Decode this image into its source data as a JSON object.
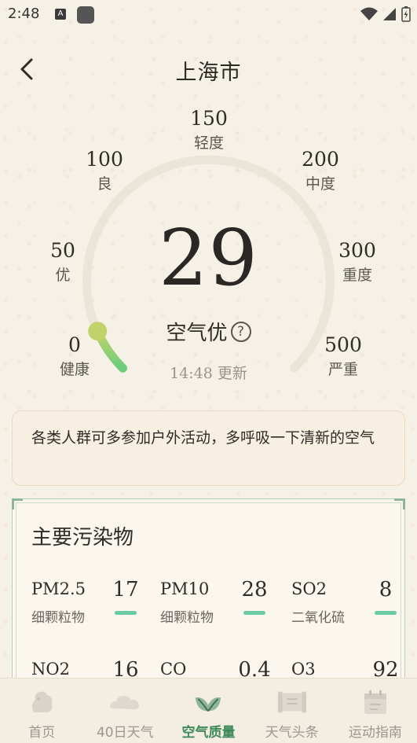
{
  "status_bar": {
    "time": "2:48",
    "notification_letter": "A"
  },
  "header": {
    "title": "上海市"
  },
  "gauge": {
    "scale": [
      {
        "value": "0",
        "label": "健康"
      },
      {
        "value": "50",
        "label": "优"
      },
      {
        "value": "100",
        "label": "良"
      },
      {
        "value": "150",
        "label": "轻度"
      },
      {
        "value": "200",
        "label": "中度"
      },
      {
        "value": "300",
        "label": "重度"
      },
      {
        "value": "500",
        "label": "严重"
      }
    ],
    "aqi": "29",
    "aqi_numeric": 29,
    "level_text": "空气优",
    "help_symbol": "?",
    "update_text": "14:48 更新",
    "colors": {
      "track": "#ebe5d8",
      "progress_start": "#c2d46a",
      "progress_end": "#6ccc7b"
    }
  },
  "advice": {
    "text": "各类人群可多参加户外活动，多呼吸一下清新的空气"
  },
  "pollutants": {
    "title": "主要污染物",
    "items": [
      {
        "name": "PM2.5",
        "desc": "细颗粒物",
        "value": "17"
      },
      {
        "name": "PM10",
        "desc": "细颗粒物",
        "value": "28"
      },
      {
        "name": "SO2",
        "desc": "二氧化硫",
        "value": "8"
      },
      {
        "name": "NO2",
        "desc": "",
        "value": "16"
      },
      {
        "name": "CO",
        "desc": "",
        "value": "0.4"
      },
      {
        "name": "O3",
        "desc": "",
        "value": "92"
      }
    ],
    "bar_color": "#6ccaa4"
  },
  "bottom_nav": {
    "items": [
      {
        "label": "首页",
        "icon": "home-icon"
      },
      {
        "label": "40日天气",
        "icon": "cloud-icon"
      },
      {
        "label": "空气质量",
        "icon": "leaf-icon",
        "active": true
      },
      {
        "label": "天气头条",
        "icon": "scroll-icon"
      },
      {
        "label": "运动指南",
        "icon": "calendar-icon"
      }
    ],
    "active_color": "#3f8a5b"
  }
}
